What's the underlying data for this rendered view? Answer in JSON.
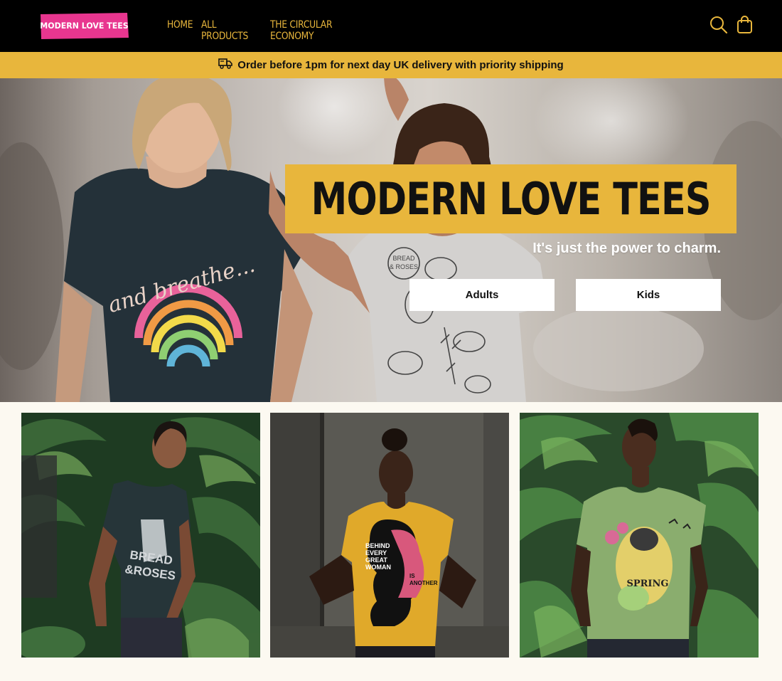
{
  "header": {
    "logo_text": "MODERN LOVE TEES",
    "nav": [
      {
        "label": "HOME"
      },
      {
        "label": "ALL PRODUCTS"
      },
      {
        "label": "THE CIRCULAR ECONOMY"
      }
    ],
    "icons": [
      "search-icon",
      "shopping-bag-icon"
    ]
  },
  "promo": {
    "icon": "delivery-truck-icon",
    "text": "Order before 1pm for next day UK delivery with priority shipping"
  },
  "hero": {
    "title": "MODERN LOVE TEES",
    "subtitle": "It's just the power to charm.",
    "buttons": {
      "adults": "Adults",
      "kids": "Kids"
    },
    "shirt_left_print": "and breathe...",
    "shirt_right_print": "BREAD & ROSES"
  },
  "tiles": [
    {
      "shirt_print": "BREAD & ROSES"
    },
    {
      "shirt_print": "BEHIND EVERY GREAT WOMAN IS ANOTHER GREAT WOMAN"
    },
    {
      "shirt_print": "SPRING"
    }
  ],
  "colors": {
    "header_bg": "#000000",
    "accent_yellow": "#e8b63c",
    "logo_pink": "#e8368f",
    "page_bg": "#fcf9f1"
  }
}
